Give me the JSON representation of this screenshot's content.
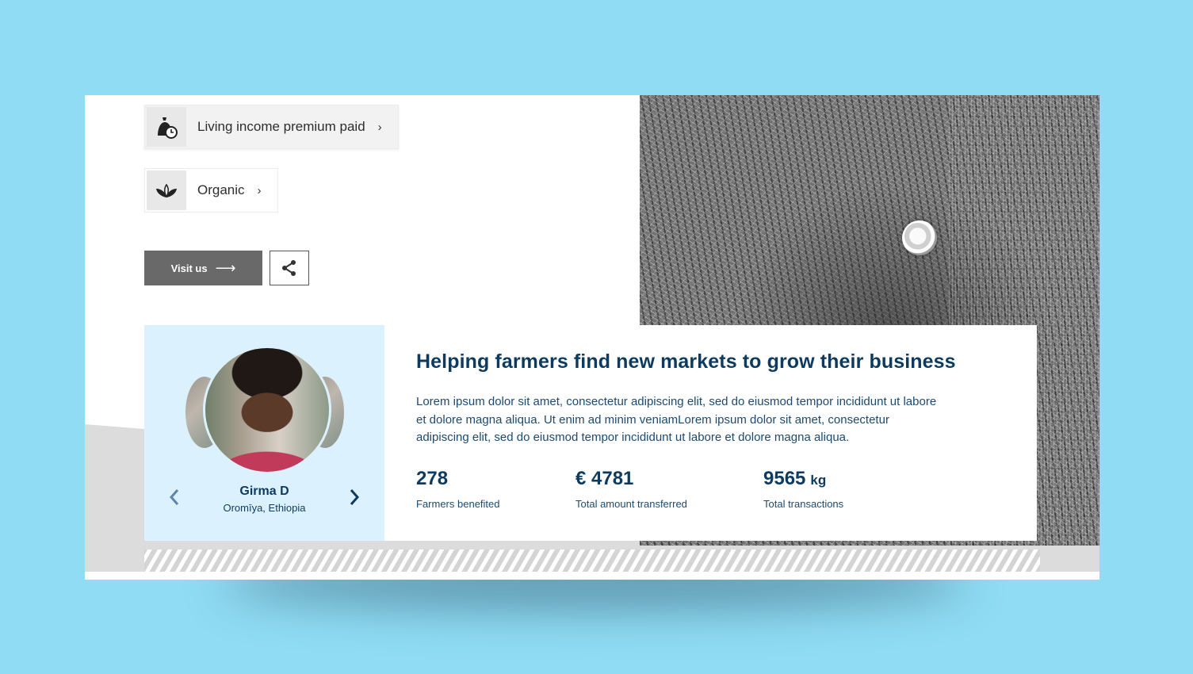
{
  "certifications": [
    {
      "label": "Living income premium paid",
      "icon": "money-bag-clock-icon",
      "chevron": "›"
    },
    {
      "label": "Organic",
      "icon": "leaf-icon",
      "chevron": "›"
    }
  ],
  "actions": {
    "visit_label": "Visit us",
    "visit_arrow": "⟶",
    "share_icon": "share-icon"
  },
  "farmer": {
    "name": "Girma D",
    "location": "Oromīya, Ethiopia"
  },
  "story": {
    "title": "Helping farmers find new markets to grow their business",
    "body": "Lorem ipsum dolor sit amet, consectetur adipiscing elit, sed do eiusmod tempor incididunt ut labore et dolore magna aliqua. Ut enim ad minim veniamLorem ipsum dolor sit amet, consectetur adipiscing elit, sed do eiusmod tempor incididunt ut labore et dolore magna aliqua."
  },
  "stats": [
    {
      "value": "278",
      "unit": "",
      "caption": "Farmers benefited"
    },
    {
      "value": "€ 4781",
      "unit": "",
      "caption": "Total amount transferred"
    },
    {
      "value": "9565",
      "unit": "kg",
      "caption": "Total transactions"
    }
  ],
  "colors": {
    "background": "#8fdcf4",
    "navy": "#0d3a5f",
    "farmer_panel": "#dcf1fe",
    "button_grey": "#696969"
  }
}
